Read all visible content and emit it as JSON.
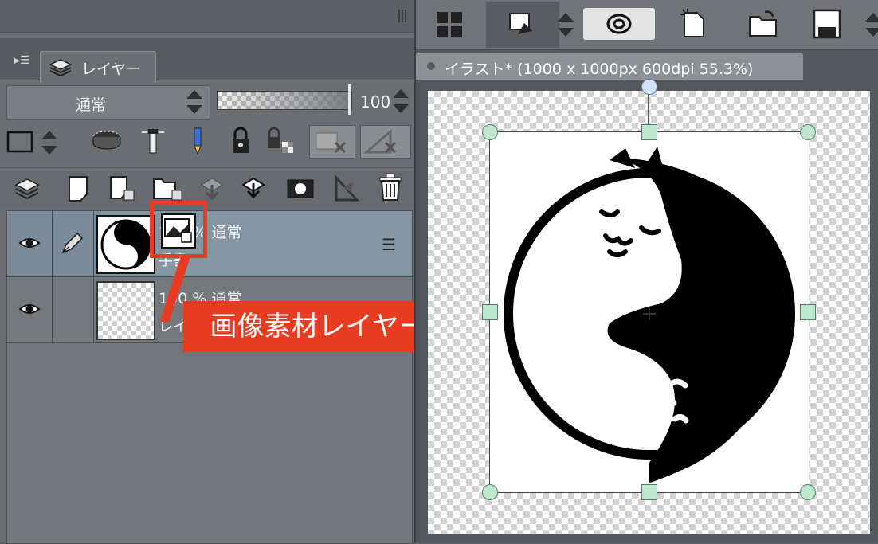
{
  "layer_panel": {
    "tab_label": "レイヤー",
    "blend_mode": "通常",
    "opacity": "100",
    "layers": [
      {
        "info_top": "100 % 通常",
        "info_bottom": "手書",
        "selected": true
      },
      {
        "info_top": "100 % 通常",
        "info_bottom": "レイ",
        "selected": false
      }
    ]
  },
  "callout": {
    "label": "画像素材レイヤー"
  },
  "document": {
    "title": "イラスト* (1000 x 1000px 600dpi 55.3%)"
  },
  "colors": {
    "accent_callout": "#e83c22",
    "selected_row": "#8495a4",
    "handle": "#bfe9cf"
  },
  "icons": {
    "toolbar": [
      "grid-icon",
      "transform-icon",
      "spinner-icon",
      "lasso-icon",
      "new-file-icon",
      "open-folder-icon",
      "save-icon"
    ],
    "layer_row1": [
      "layer-color-icon",
      "mask-ellipse-icon",
      "lighthouse-icon",
      "pencil-icon",
      "lock-icon",
      "lock-transparent-icon",
      "mask-icon",
      "ruler-icon"
    ],
    "layer_row2": [
      "layers-icon",
      "new-raster-layer-icon",
      "new-vector-layer-icon",
      "new-folder-icon",
      "merge-down-icon",
      "combine-icon",
      "mask-create-icon",
      "ruler-tool-icon",
      "trash-icon"
    ]
  }
}
